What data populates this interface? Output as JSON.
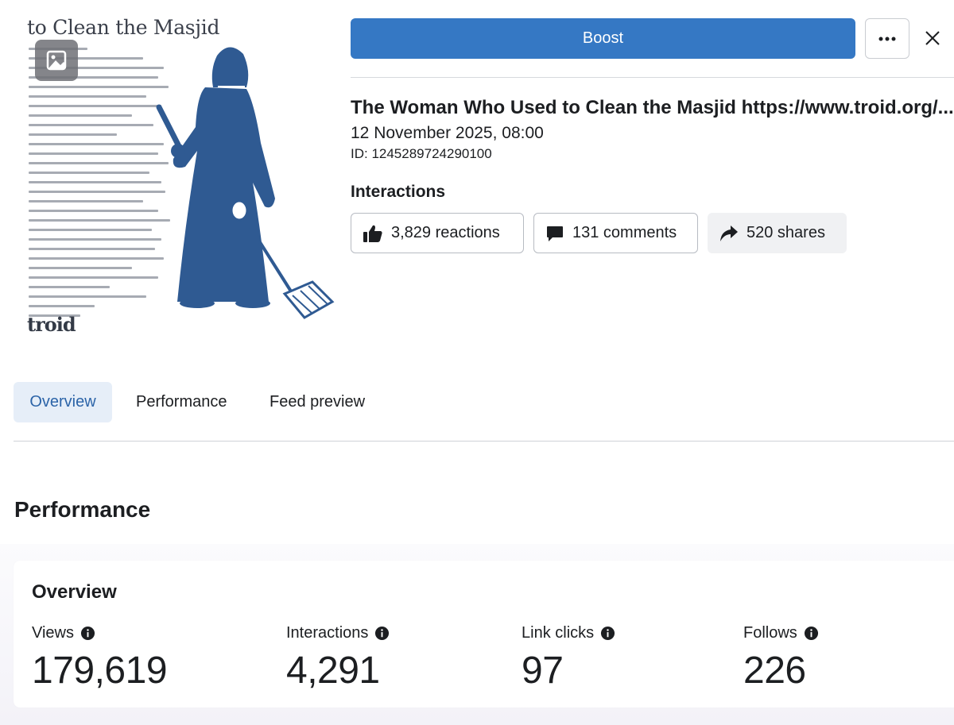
{
  "thumbnail": {
    "title_text": "to Clean the Masjid",
    "brand": "troid",
    "badge_icon": "image-icon"
  },
  "header": {
    "boost_label": "Boost",
    "more_icon": "more-horizontal-icon",
    "close_icon": "close-icon"
  },
  "post": {
    "title": "The Woman Who Used to Clean the Masjid https://www.troid.org/...",
    "date": "12 November 2025, 08:00",
    "id": "ID: 1245289724290100"
  },
  "interactions": {
    "label": "Interactions",
    "chips": [
      {
        "icon": "thumbs-up-icon",
        "label": "3,829 reactions"
      },
      {
        "icon": "comment-icon",
        "label": "131 comments"
      },
      {
        "icon": "share-icon",
        "label": "520 shares"
      }
    ]
  },
  "tabs": [
    {
      "label": "Overview",
      "active": true
    },
    {
      "label": "Performance"
    },
    {
      "label": "Feed preview"
    }
  ],
  "performance": {
    "section_title": "Performance",
    "card_title": "Overview",
    "metrics": [
      {
        "label": "Views",
        "value": "179,619"
      },
      {
        "label": "Interactions",
        "value": "4,291"
      },
      {
        "label": "Link clicks",
        "value": "97"
      },
      {
        "label": "Follows",
        "value": "226"
      }
    ]
  },
  "colors": {
    "boost": "#3578c4",
    "tab_active_bg": "#e6eef8",
    "tab_active_text": "#2c64a8",
    "figure": "#2f5a92"
  }
}
